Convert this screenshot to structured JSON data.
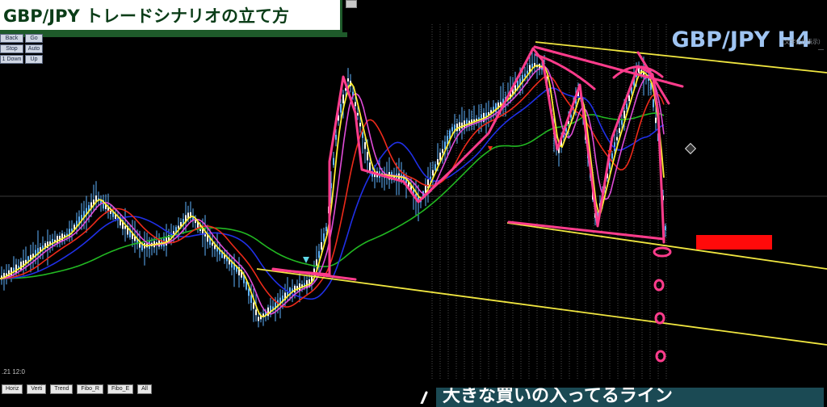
{
  "title": "GBP/JPY トレードシナリオの立て方",
  "symbol": "GBP/JPY H4",
  "corner_info": [
    "（文字化け表示）",
    "―"
  ],
  "time_label": ".21 12:0",
  "subtitle": "大きな買いの入ってるライン",
  "nav_buttons": [
    {
      "label": "Back",
      "icon": "back"
    },
    {
      "label": "Go",
      "icon": "go"
    },
    {
      "label": "Stop",
      "icon": "stop"
    },
    {
      "label": "Auto",
      "icon": "auto"
    },
    {
      "label": "1 Down",
      "icon": "down"
    },
    {
      "label": "Up",
      "icon": "up"
    }
  ],
  "tool_buttons": [
    "Horiz",
    "Verti",
    "Trend",
    "Fibo_R",
    "Fibo_E",
    "All"
  ],
  "colors": {
    "background": "#000000",
    "candle": "#5fb4ff",
    "ma_yellow": "#ffee33",
    "ma_magenta": "#e04cd8",
    "ma_red": "#ee2a1a",
    "ma_blue": "#2030e8",
    "ma_green": "#22b822",
    "channel": "#f0e640",
    "annotation": "#ff3c8c",
    "marker": "#ff0a0a"
  }
}
